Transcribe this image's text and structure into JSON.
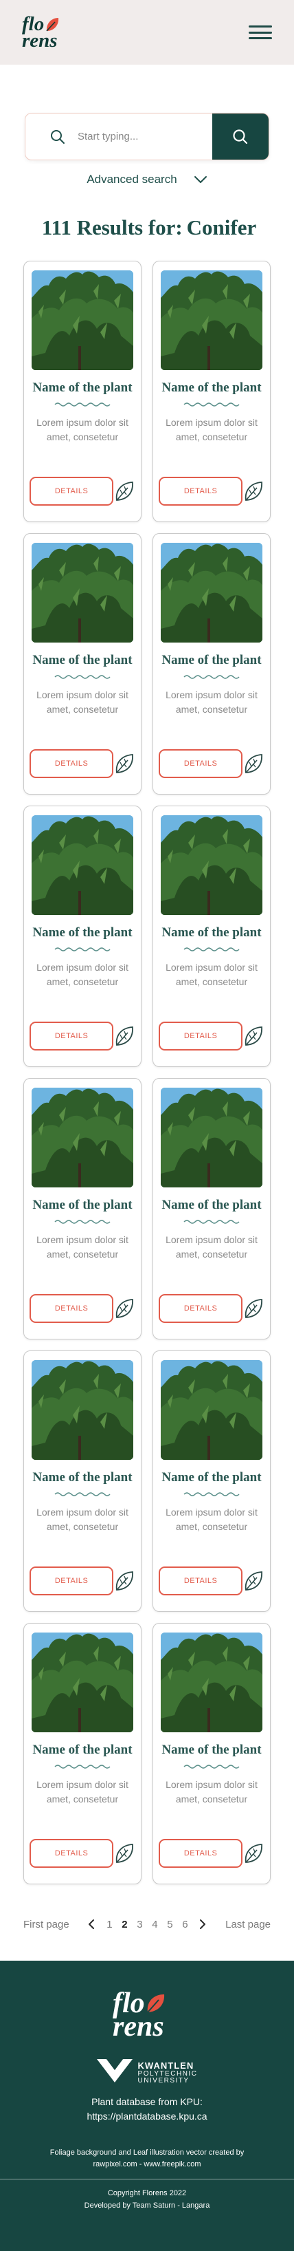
{
  "header": {
    "logo_line1": "flo",
    "logo_line2": "rens",
    "menu_icon": "hamburger-menu-icon"
  },
  "search": {
    "placeholder": "Start typing...",
    "advanced_label": "Advanced search",
    "search_icon": "search-icon",
    "accent": "#174641"
  },
  "results": {
    "title_count": "111 Results for:",
    "title_query": "Conifer"
  },
  "cards": [
    {
      "title": "Name of the plant",
      "desc": "Lorem ipsum dolor sit amet, consetetur",
      "button": "DETAILS"
    },
    {
      "title": "Name of the plant",
      "desc": "Lorem ipsum dolor sit amet, consetetur",
      "button": "DETAILS"
    },
    {
      "title": "Name of the plant",
      "desc": "Lorem ipsum dolor sit amet, consetetur",
      "button": "DETAILS"
    },
    {
      "title": "Name of the plant",
      "desc": "Lorem ipsum dolor sit amet, consetetur",
      "button": "DETAILS"
    },
    {
      "title": "Name of the plant",
      "desc": "Lorem ipsum dolor sit amet, consetetur",
      "button": "DETAILS"
    },
    {
      "title": "Name of the plant",
      "desc": "Lorem ipsum dolor sit amet, consetetur",
      "button": "DETAILS"
    },
    {
      "title": "Name of the plant",
      "desc": "Lorem ipsum dolor sit amet, consetetur",
      "button": "DETAILS"
    },
    {
      "title": "Name of the plant",
      "desc": "Lorem ipsum dolor sit amet, consetetur",
      "button": "DETAILS"
    },
    {
      "title": "Name of the plant",
      "desc": "Lorem ipsum dolor sit amet, consetetur",
      "button": "DETAILS"
    },
    {
      "title": "Name of the plant",
      "desc": "Lorem ipsum dolor sit amet, consetetur",
      "button": "DETAILS"
    },
    {
      "title": "Name of the plant",
      "desc": "Lorem ipsum dolor sit amet, consetetur",
      "button": "DETAILS"
    },
    {
      "title": "Name of the plant",
      "desc": "Lorem ipsum dolor sit amet, consetetur",
      "button": "DETAILS"
    }
  ],
  "pagination": {
    "first": "First page",
    "last": "Last page",
    "pages": [
      "1",
      "2",
      "3",
      "4",
      "5",
      "6"
    ],
    "current": "2"
  },
  "footer": {
    "logo_line1": "flo",
    "logo_line2": "rens",
    "kpu_line1": "KWANTLEN",
    "kpu_line2": "POLYTECHNIC",
    "kpu_line3": "UNIVERSITY",
    "db_line1": "Plant database from KPU:",
    "db_line2": "https://plantdatabase.kpu.ca",
    "credit_line1": "Foliage background and Leaf illustration vector created by",
    "credit_line2": "rawpixel.com - www.freepik.com",
    "copyright": "Copyright Florens 2022",
    "developed": "Developed by Team Saturn - Langara"
  },
  "colors": {
    "brand_dark": "#174641",
    "accent_coral": "#e25c4c",
    "header_bg": "#f1eceb"
  }
}
